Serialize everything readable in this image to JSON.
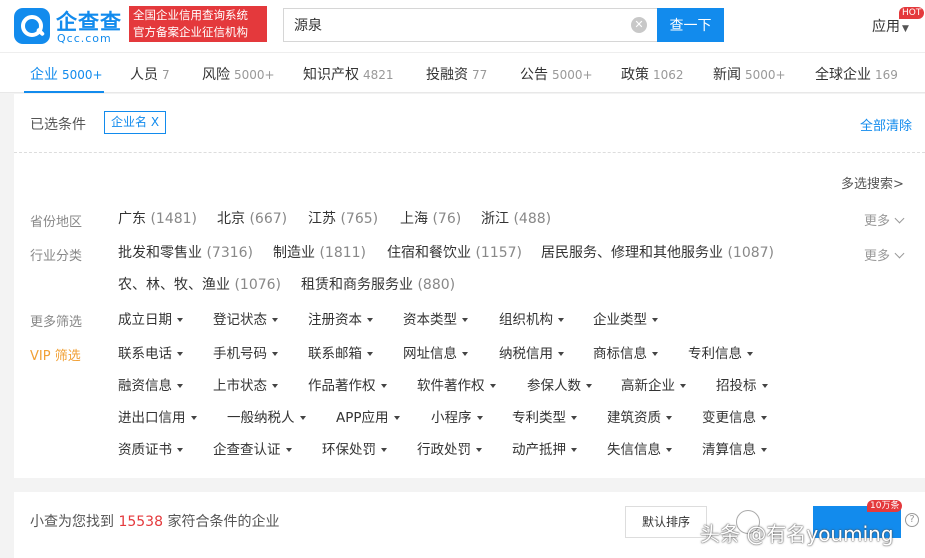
{
  "header": {
    "logo_cn": "企查查",
    "logo_en": "Qcc.com",
    "slogan_line1": "全国企业信用查询系统",
    "slogan_line2": "官方备案企业征信机构",
    "search_value": "源泉",
    "search_button": "查一下",
    "apps_label": "应用",
    "hot_badge": "HOT"
  },
  "tabs": [
    {
      "label": "企业",
      "count": "5000+"
    },
    {
      "label": "人员",
      "count": "7"
    },
    {
      "label": "风险",
      "count": "5000+"
    },
    {
      "label": "知识产权",
      "count": "4821"
    },
    {
      "label": "投融资",
      "count": "77"
    },
    {
      "label": "公告",
      "count": "5000+"
    },
    {
      "label": "政策",
      "count": "1062"
    },
    {
      "label": "新闻",
      "count": "5000+"
    },
    {
      "label": "全球企业",
      "count": "169"
    }
  ],
  "selected": {
    "label": "已选条件",
    "tag": "企业名 X",
    "clear_all": "全部清除"
  },
  "multi_search": "多选搜索>",
  "more_label": "更多",
  "filters": {
    "region": {
      "label": "省份地区",
      "options": [
        {
          "name": "广东",
          "count": "(1481)"
        },
        {
          "name": "北京",
          "count": "(667)"
        },
        {
          "name": "江苏",
          "count": "(765)"
        },
        {
          "name": "上海",
          "count": "(76)"
        },
        {
          "name": "浙江",
          "count": "(488)"
        }
      ]
    },
    "industry": {
      "label": "行业分类",
      "options": [
        {
          "name": "批发和零售业",
          "count": "(7316)"
        },
        {
          "name": "制造业",
          "count": "(1811)"
        },
        {
          "name": "住宿和餐饮业",
          "count": "(1157)"
        },
        {
          "name": "居民服务、修理和其他服务业",
          "count": "(1087)"
        },
        {
          "name": "农、林、牧、渔业",
          "count": "(1076)"
        },
        {
          "name": "租赁和商务服务业",
          "count": "(880)"
        }
      ]
    },
    "more_label": "更多筛选",
    "vip_label": "VIP 筛选",
    "dropdowns": [
      [
        "成立日期",
        "登记状态",
        "注册资本",
        "资本类型",
        "组织机构",
        "企业类型"
      ],
      [
        "联系电话",
        "手机号码",
        "联系邮箱",
        "网址信息",
        "纳税信用",
        "商标信息",
        "专利信息"
      ],
      [
        "融资信息",
        "上市状态",
        "作品著作权",
        "软件著作权",
        "参保人数",
        "高新企业",
        "招投标"
      ],
      [
        "进出口信用",
        "一般纳税人",
        "APP应用",
        "小程序",
        "专利类型",
        "建筑资质",
        "变更信息"
      ],
      [
        "资质证书",
        "企查查认证",
        "环保处罚",
        "行政处罚",
        "动产抵押",
        "失信信息",
        "清算信息"
      ]
    ]
  },
  "result": {
    "prefix": "小查为您找到",
    "count": "15538",
    "suffix": "家符合条件的企业",
    "sort_button": "默认排序",
    "badge": "10万条",
    "help": "?",
    "watermark": "头条 @有名youming"
  },
  "colors": {
    "brand": "#128bed",
    "red": "#e4393c",
    "vip": "#f1a035"
  }
}
